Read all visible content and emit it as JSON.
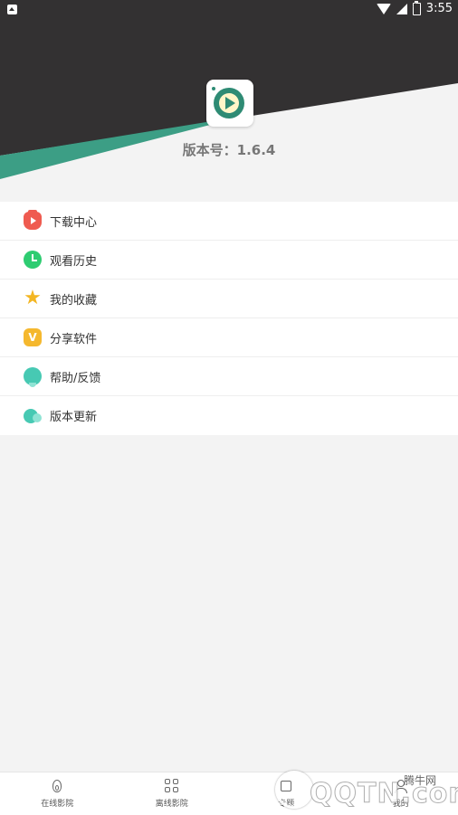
{
  "status_bar": {
    "time": "3:55"
  },
  "header": {
    "version_text": "版本号：1.6.4"
  },
  "menu": [
    {
      "label": "下载中心",
      "icon": "download-center-icon"
    },
    {
      "label": "观看历史",
      "icon": "history-clock-icon"
    },
    {
      "label": "我的收藏",
      "icon": "star-icon"
    },
    {
      "label": "分享软件",
      "icon": "share-v-icon"
    },
    {
      "label": "帮助/反馈",
      "icon": "help-bulb-icon"
    },
    {
      "label": "版本更新",
      "icon": "update-cloud-icon"
    }
  ],
  "tabs": [
    {
      "label": "在线影院",
      "icon": "flame-icon"
    },
    {
      "label": "离线影院",
      "icon": "grid-icon"
    },
    {
      "label": "专题",
      "icon": "topic-icon"
    },
    {
      "label": "我的",
      "icon": "user-icon"
    }
  ],
  "watermark": {
    "brand": "QQTN.com",
    "cn": "腾牛网"
  },
  "colors": {
    "dark_band": "#333132",
    "teal": "#3c9e85",
    "background": "#f3f3f3"
  }
}
